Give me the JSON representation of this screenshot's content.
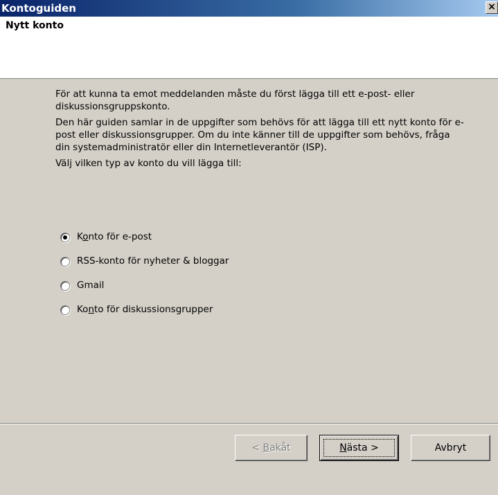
{
  "window": {
    "title": "Kontoguiden",
    "close_label": "×"
  },
  "header": {
    "title": "Nytt konto"
  },
  "content": {
    "paragraph1": "För att kunna ta emot meddelanden måste du först lägga till ett e-post- eller diskussionsgruppskonto.",
    "paragraph2": "Den här guiden samlar in de uppgifter som behövs för att lägga till ett nytt konto för e-post eller diskussionsgrupper. Om du inte känner till de uppgifter som behövs, fråga din systemadministratör eller din Internetleverantör (ISP).",
    "paragraph3": "Välj vilken typ av konto du vill lägga till:"
  },
  "account_types": [
    {
      "pre": "K",
      "accel": "o",
      "post": "nto för e-post",
      "checked": true
    },
    {
      "pre": "",
      "accel": "",
      "post": "RSS-konto för nyheter & bloggar",
      "checked": false
    },
    {
      "pre": "",
      "accel": "",
      "post": "Gmail",
      "checked": false
    },
    {
      "pre": "Ko",
      "accel": "n",
      "post": "to för diskussionsgrupper",
      "checked": false
    }
  ],
  "buttons": {
    "back": {
      "pre": "< ",
      "accel": "B",
      "post": "akåt",
      "disabled": true
    },
    "next": {
      "pre": "",
      "accel": "N",
      "post": "ästa >"
    },
    "cancel": {
      "label": "Avbryt"
    }
  }
}
